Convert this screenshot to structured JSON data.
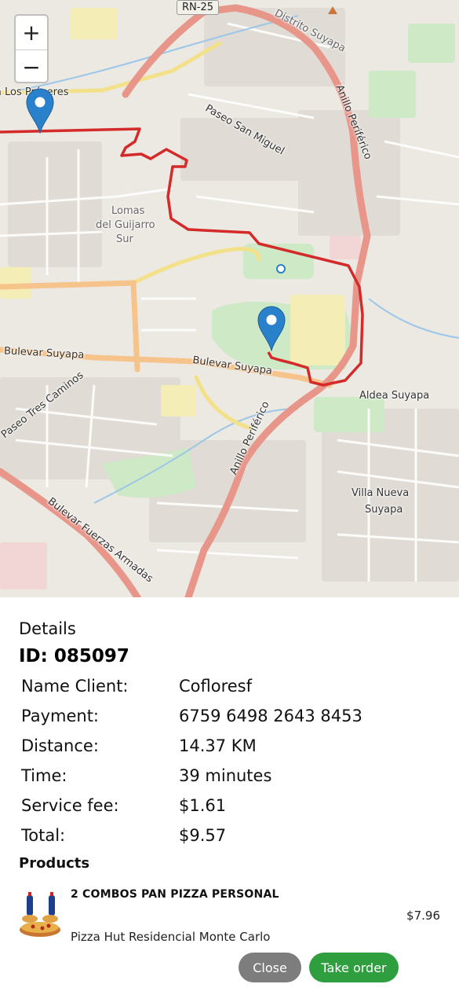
{
  "map": {
    "zoom_in_label": "+",
    "zoom_out_label": "−",
    "highway_shield": "RN-25",
    "labels": {
      "avenida_proceres": "Avenida Los Próceres",
      "distrito_suyapa": "Distrito Suyapa",
      "paseo_san_miguel": "Paseo San Miguel",
      "anillo_periferico_north": "Anillo Periférico",
      "lomas_line1": "Lomas",
      "lomas_line2": "del Guijarro",
      "lomas_line3": "Sur",
      "bulevar_suyapa_west": "Bulevar Suyapa",
      "bulevar_suyapa_east": "Bulevar Suyapa",
      "aldea_suyapa": "Aldea Suyapa",
      "paseo_tres_caminos": "Paseo Tres Caminos",
      "anillo_periferico_south": "Anillo Periférico",
      "villa_nueva_line1": "Villa Nueva",
      "villa_nueva_line2": "Suyapa",
      "bulevar_fuerzas_armadas": "Bulevar Fuerzas Armadas"
    },
    "route_color": "#d42a2a",
    "pin_color": "#2a81cb"
  },
  "details": {
    "title": "Details",
    "order_id": "ID: 085097",
    "fields": [
      {
        "label": "Name Client:",
        "value": "Cofloresf"
      },
      {
        "label": "Payment:",
        "value": "6759 6498 2643 8453"
      },
      {
        "label": "Distance:",
        "value": "14.37 KM"
      },
      {
        "label": "Time:",
        "value": "39 minutes"
      },
      {
        "label": "Service fee:",
        "value": "$1.61"
      },
      {
        "label": "Total:",
        "value": "$9.57"
      }
    ],
    "products_heading": "Products",
    "products": [
      {
        "name": "2 COMBOS PAN PIZZA PERSONAL",
        "store": "Pizza Hut Residencial Monte Carlo",
        "price": "$7.96"
      }
    ]
  },
  "actions": {
    "close_label": "Close",
    "take_order_label": "Take order",
    "close_color": "#7d7d7d",
    "take_order_color": "#2e9e3e"
  }
}
